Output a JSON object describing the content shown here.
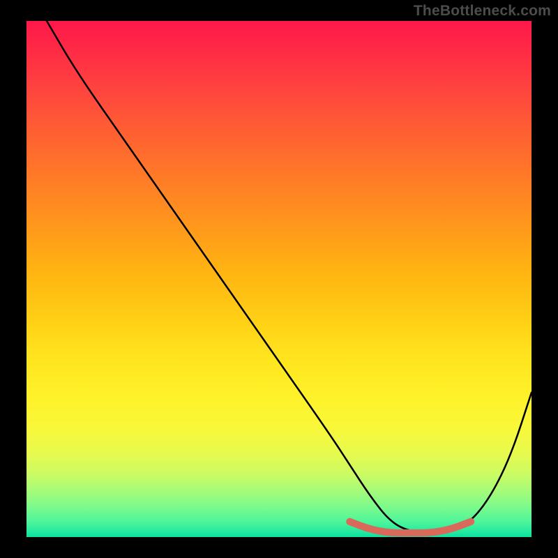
{
  "watermark": "TheBottleneck.com",
  "chart_data": {
    "type": "line",
    "title": "",
    "xlabel": "",
    "ylabel": "",
    "xlim": [
      0,
      100
    ],
    "ylim": [
      0,
      100
    ],
    "series": [
      {
        "name": "main-curve",
        "x": [
          4,
          10,
          20,
          30,
          40,
          50,
          60,
          64,
          68,
          72,
          76,
          80,
          84,
          88,
          92,
          96,
          100
        ],
        "values": [
          100,
          90,
          76,
          62,
          48,
          34,
          20,
          14,
          8,
          3,
          1,
          1,
          1,
          3,
          8,
          16,
          28
        ]
      },
      {
        "name": "highlight-segment",
        "x": [
          64,
          68,
          72,
          76,
          80,
          84,
          88
        ],
        "values": [
          3,
          1.5,
          0.8,
          0.8,
          0.8,
          1.5,
          3
        ]
      }
    ],
    "highlight_color": "#d96a5b",
    "curve_color": "#000000"
  }
}
